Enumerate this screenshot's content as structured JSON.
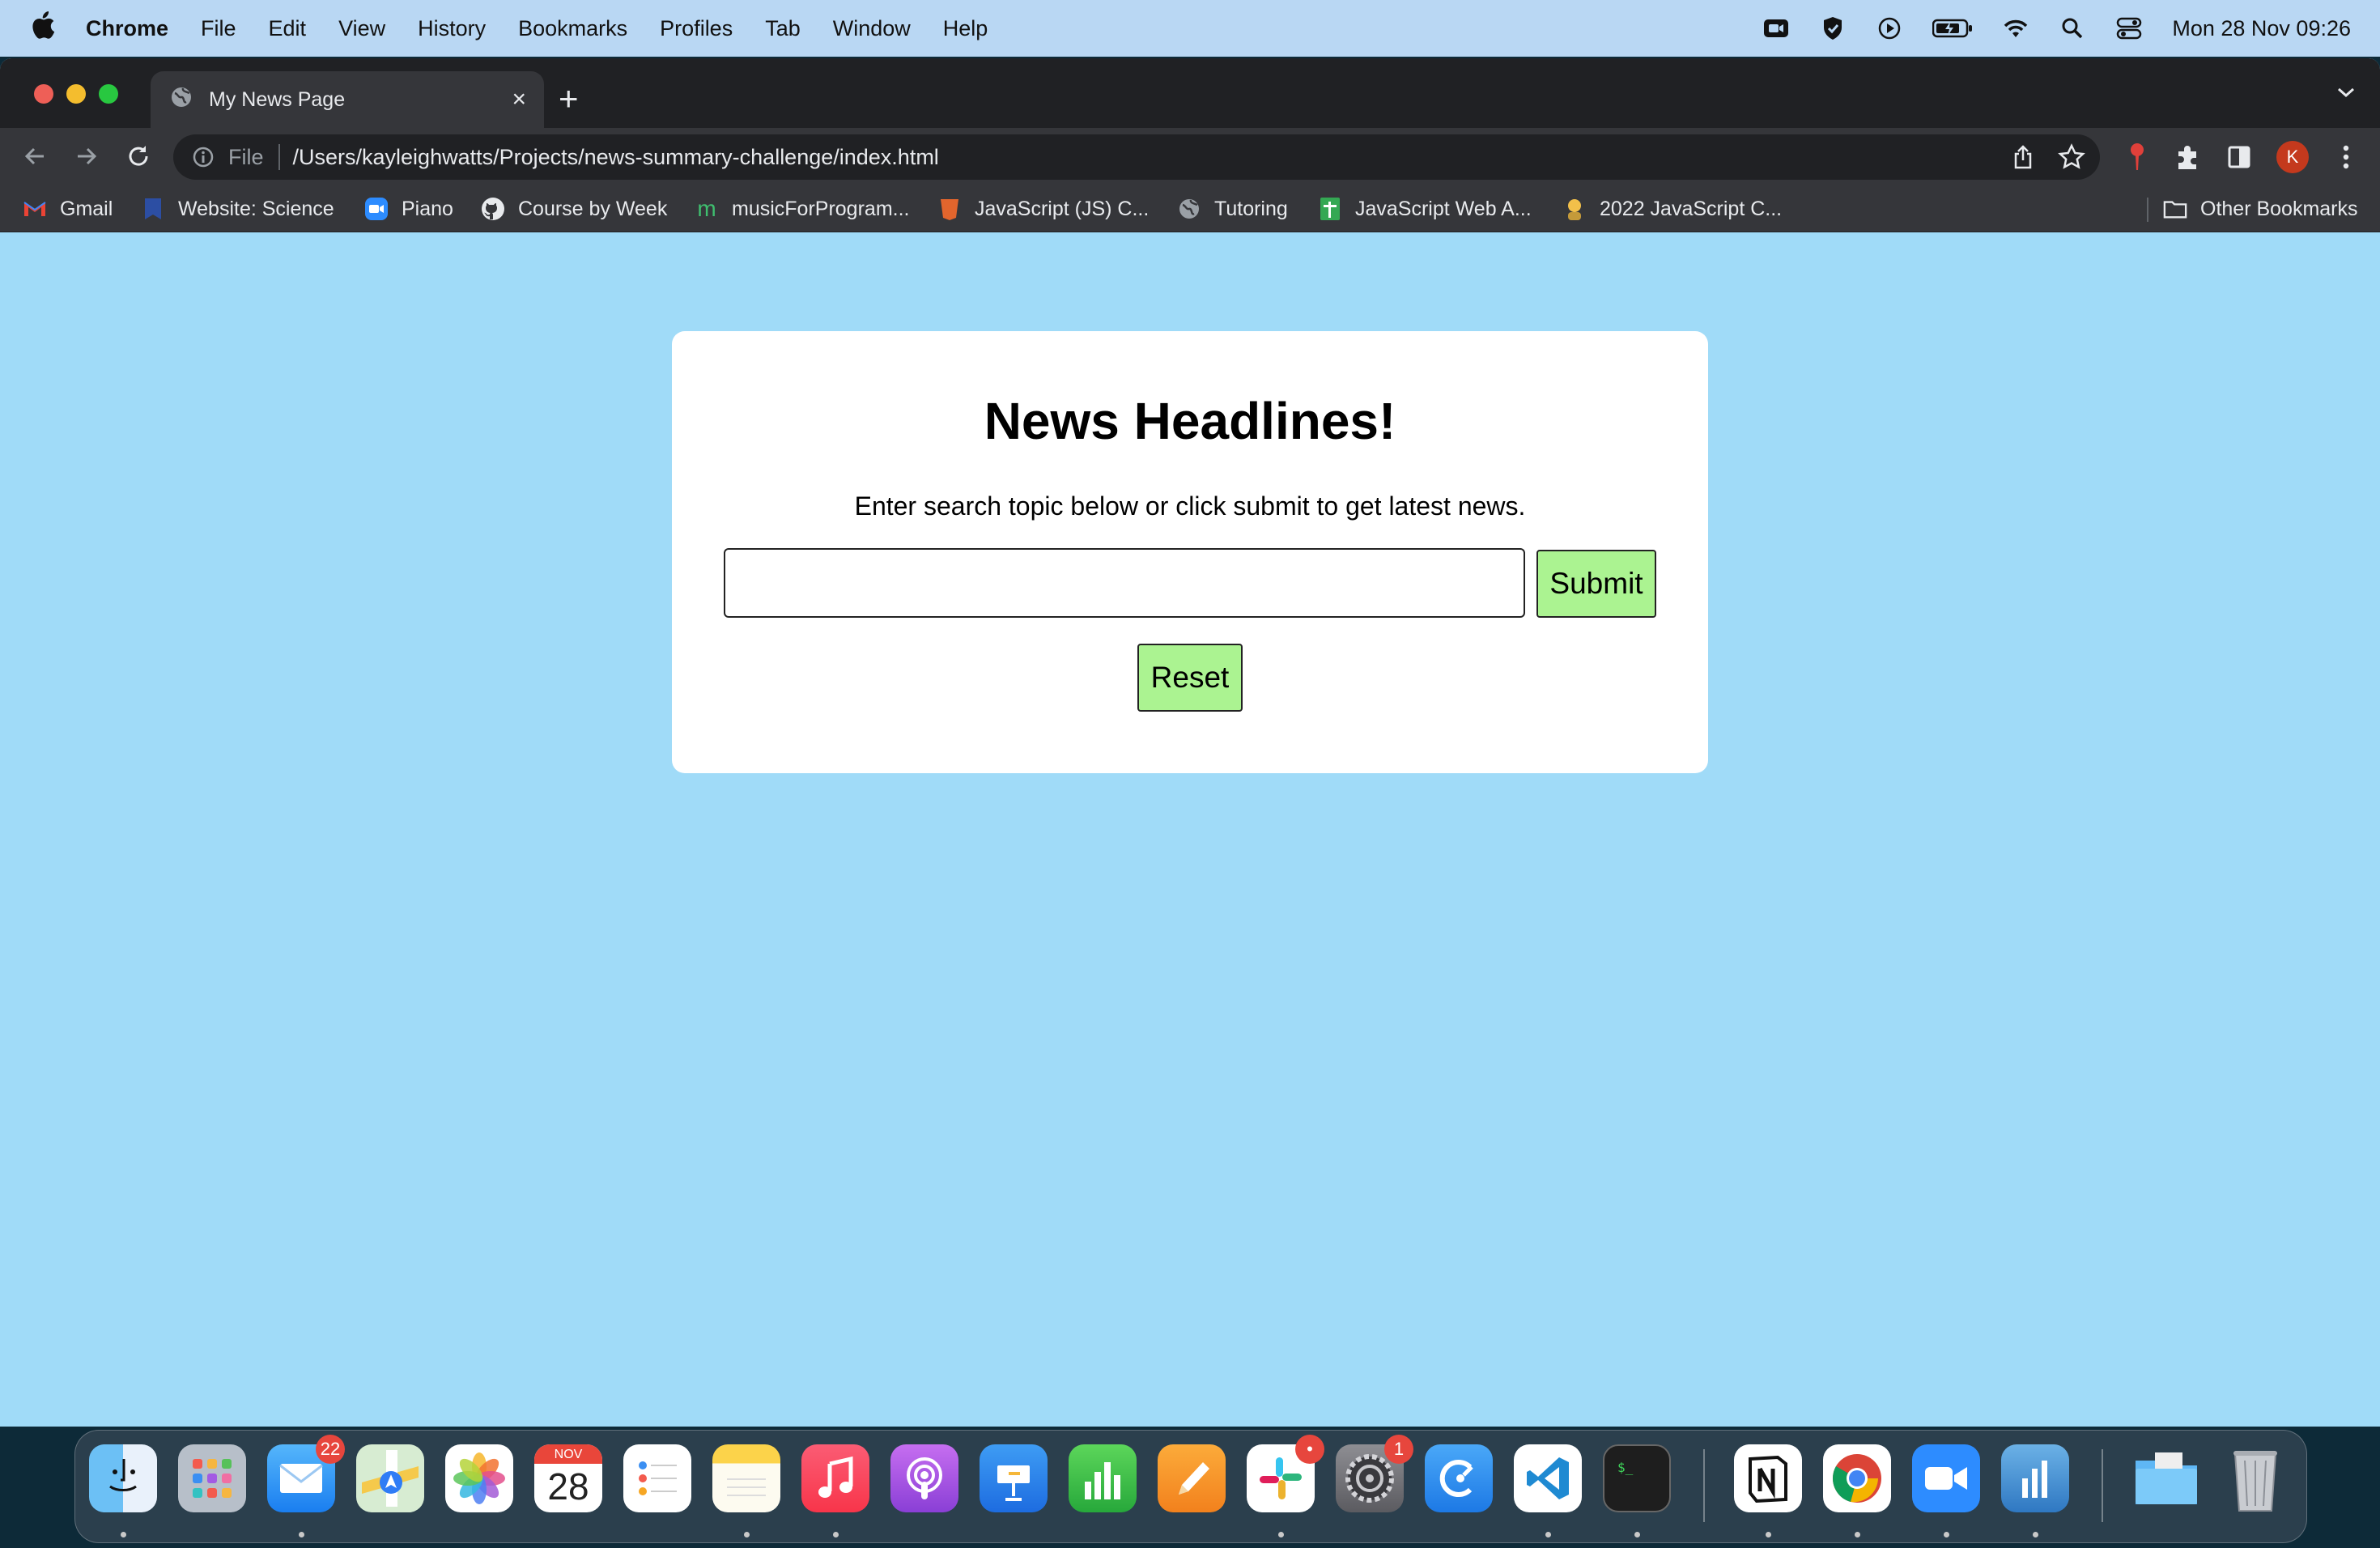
{
  "menubar": {
    "app": "Chrome",
    "items": [
      "File",
      "Edit",
      "View",
      "History",
      "Bookmarks",
      "Profiles",
      "Tab",
      "Window",
      "Help"
    ],
    "status_icons": [
      "zoom-icon",
      "shield-icon",
      "play-icon",
      "battery-icon",
      "wifi-icon",
      "spotlight-search-icon",
      "control-center-icon"
    ],
    "clock": "Mon 28 Nov  09:26"
  },
  "browser": {
    "tab_title": "My News Page",
    "address_scheme": "File",
    "address_url": "/Users/kayleighwatts/Projects/news-summary-challenge/index.html",
    "profile_initial": "K",
    "bookmarks": [
      {
        "label": "Gmail",
        "icon": "gmail-icon"
      },
      {
        "label": "Website: Science",
        "icon": "bookmark-icon"
      },
      {
        "label": "Piano",
        "icon": "zoom-icon"
      },
      {
        "label": "Course by Week",
        "icon": "github-icon"
      },
      {
        "label": "musicForProgram...",
        "icon": "m-icon"
      },
      {
        "label": "JavaScript (JS) C...",
        "icon": "shield-icon"
      },
      {
        "label": "Tutoring",
        "icon": "globe-icon"
      },
      {
        "label": "JavaScript Web A...",
        "icon": "sheets-icon"
      },
      {
        "label": "2022 JavaScript C...",
        "icon": "avatar-icon"
      }
    ],
    "other_bookmarks": "Other Bookmarks"
  },
  "page": {
    "heading": "News Headlines!",
    "instructions": "Enter search topic below or click submit to get latest news.",
    "search_value": "",
    "submit_label": "Submit",
    "reset_label": "Reset",
    "colors": {
      "background": "#a0dbf8",
      "card": "#ffffff",
      "button": "#abf391"
    }
  },
  "dock": {
    "apps": [
      "Finder",
      "Launchpad",
      "Mail",
      "Maps",
      "Photos",
      "Calendar",
      "Reminders",
      "Notes",
      "Music",
      "Podcasts",
      "Keynote",
      "Numbers",
      "Pages",
      "Slack",
      "System Preferences",
      "Clockify",
      "Visual Studio Code",
      "Terminal",
      "Notion",
      "Google Chrome",
      "Zoom",
      "Instruments",
      "Folder",
      "Trash"
    ],
    "mail_badge": "22",
    "slack_badge": "•",
    "settings_badge": "1",
    "calendar_month": "NOV",
    "calendar_day": "28"
  }
}
